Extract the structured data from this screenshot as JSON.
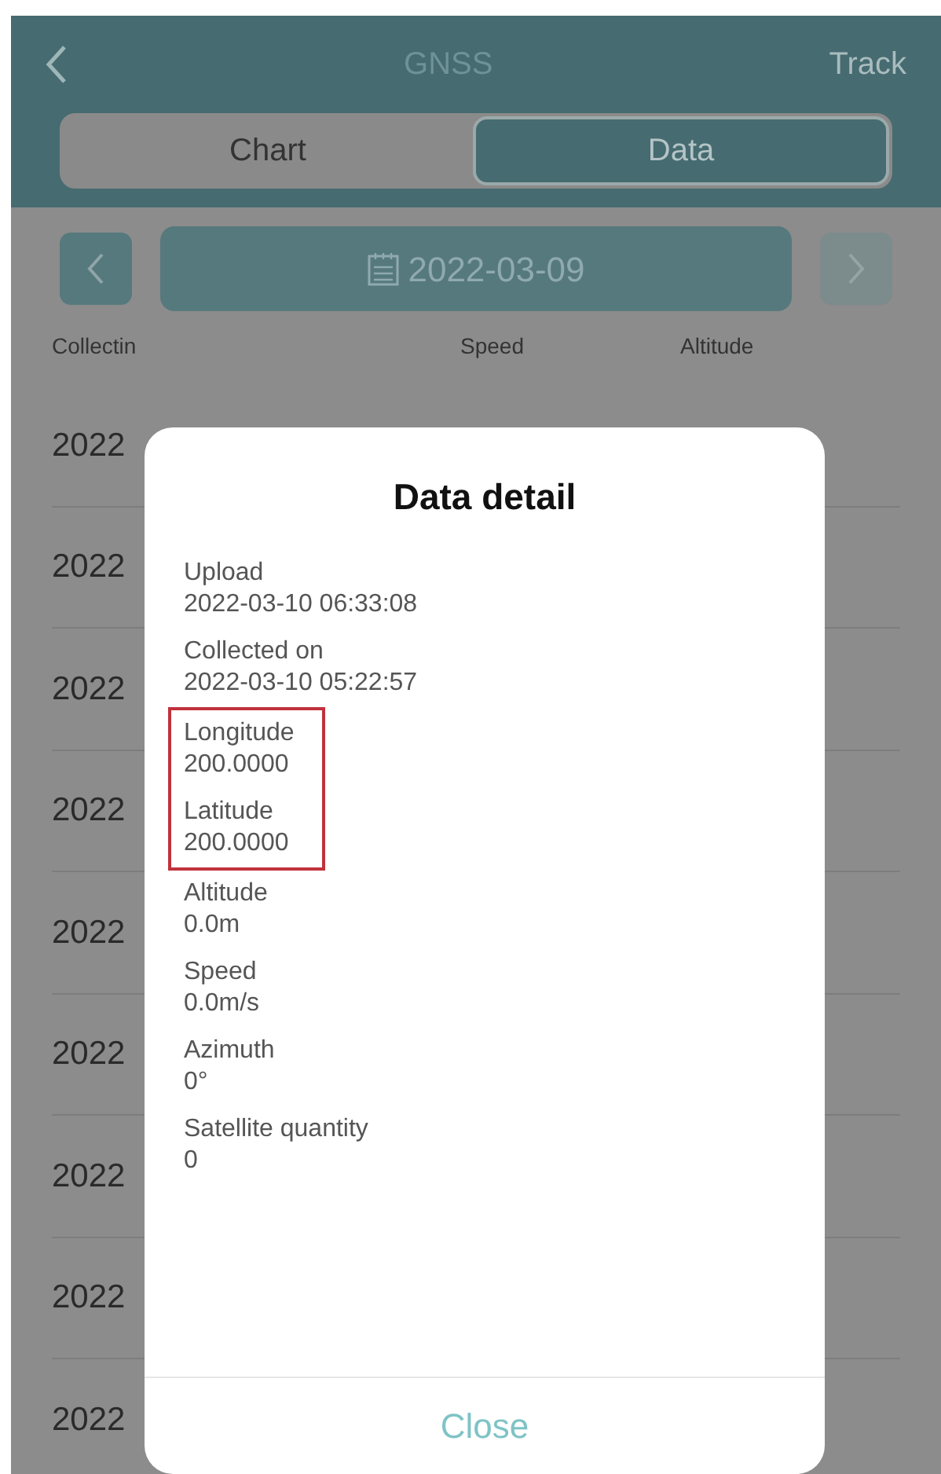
{
  "nav": {
    "title": "GNSS",
    "action": "Track"
  },
  "tabs": [
    {
      "label": "Chart",
      "selected": false
    },
    {
      "label": "Data",
      "selected": true
    }
  ],
  "date": "2022-03-09",
  "table": {
    "columns": [
      "Collectin",
      "Speed",
      "Altitude"
    ],
    "rows": [
      "2022",
      "2022",
      "2022",
      "2022",
      "2022",
      "2022",
      "2022",
      "2022",
      "2022"
    ]
  },
  "dialog": {
    "title": "Data detail",
    "fields": [
      {
        "label": "Upload",
        "value": "2022-03-10 06:33:08",
        "highlighted": false
      },
      {
        "label": "Collected on",
        "value": "2022-03-10 05:22:57",
        "highlighted": false
      },
      {
        "label": "Longitude",
        "value": "200.0000",
        "highlighted": true
      },
      {
        "label": "Latitude",
        "value": "200.0000",
        "highlighted": true
      },
      {
        "label": "Altitude",
        "value": "0.0m",
        "highlighted": false
      },
      {
        "label": "Speed",
        "value": "0.0m/s",
        "highlighted": false
      },
      {
        "label": "Azimuth",
        "value": "0°",
        "highlighted": false
      },
      {
        "label": "Satellite quantity",
        "value": "0",
        "highlighted": false
      }
    ],
    "button": "Close"
  }
}
